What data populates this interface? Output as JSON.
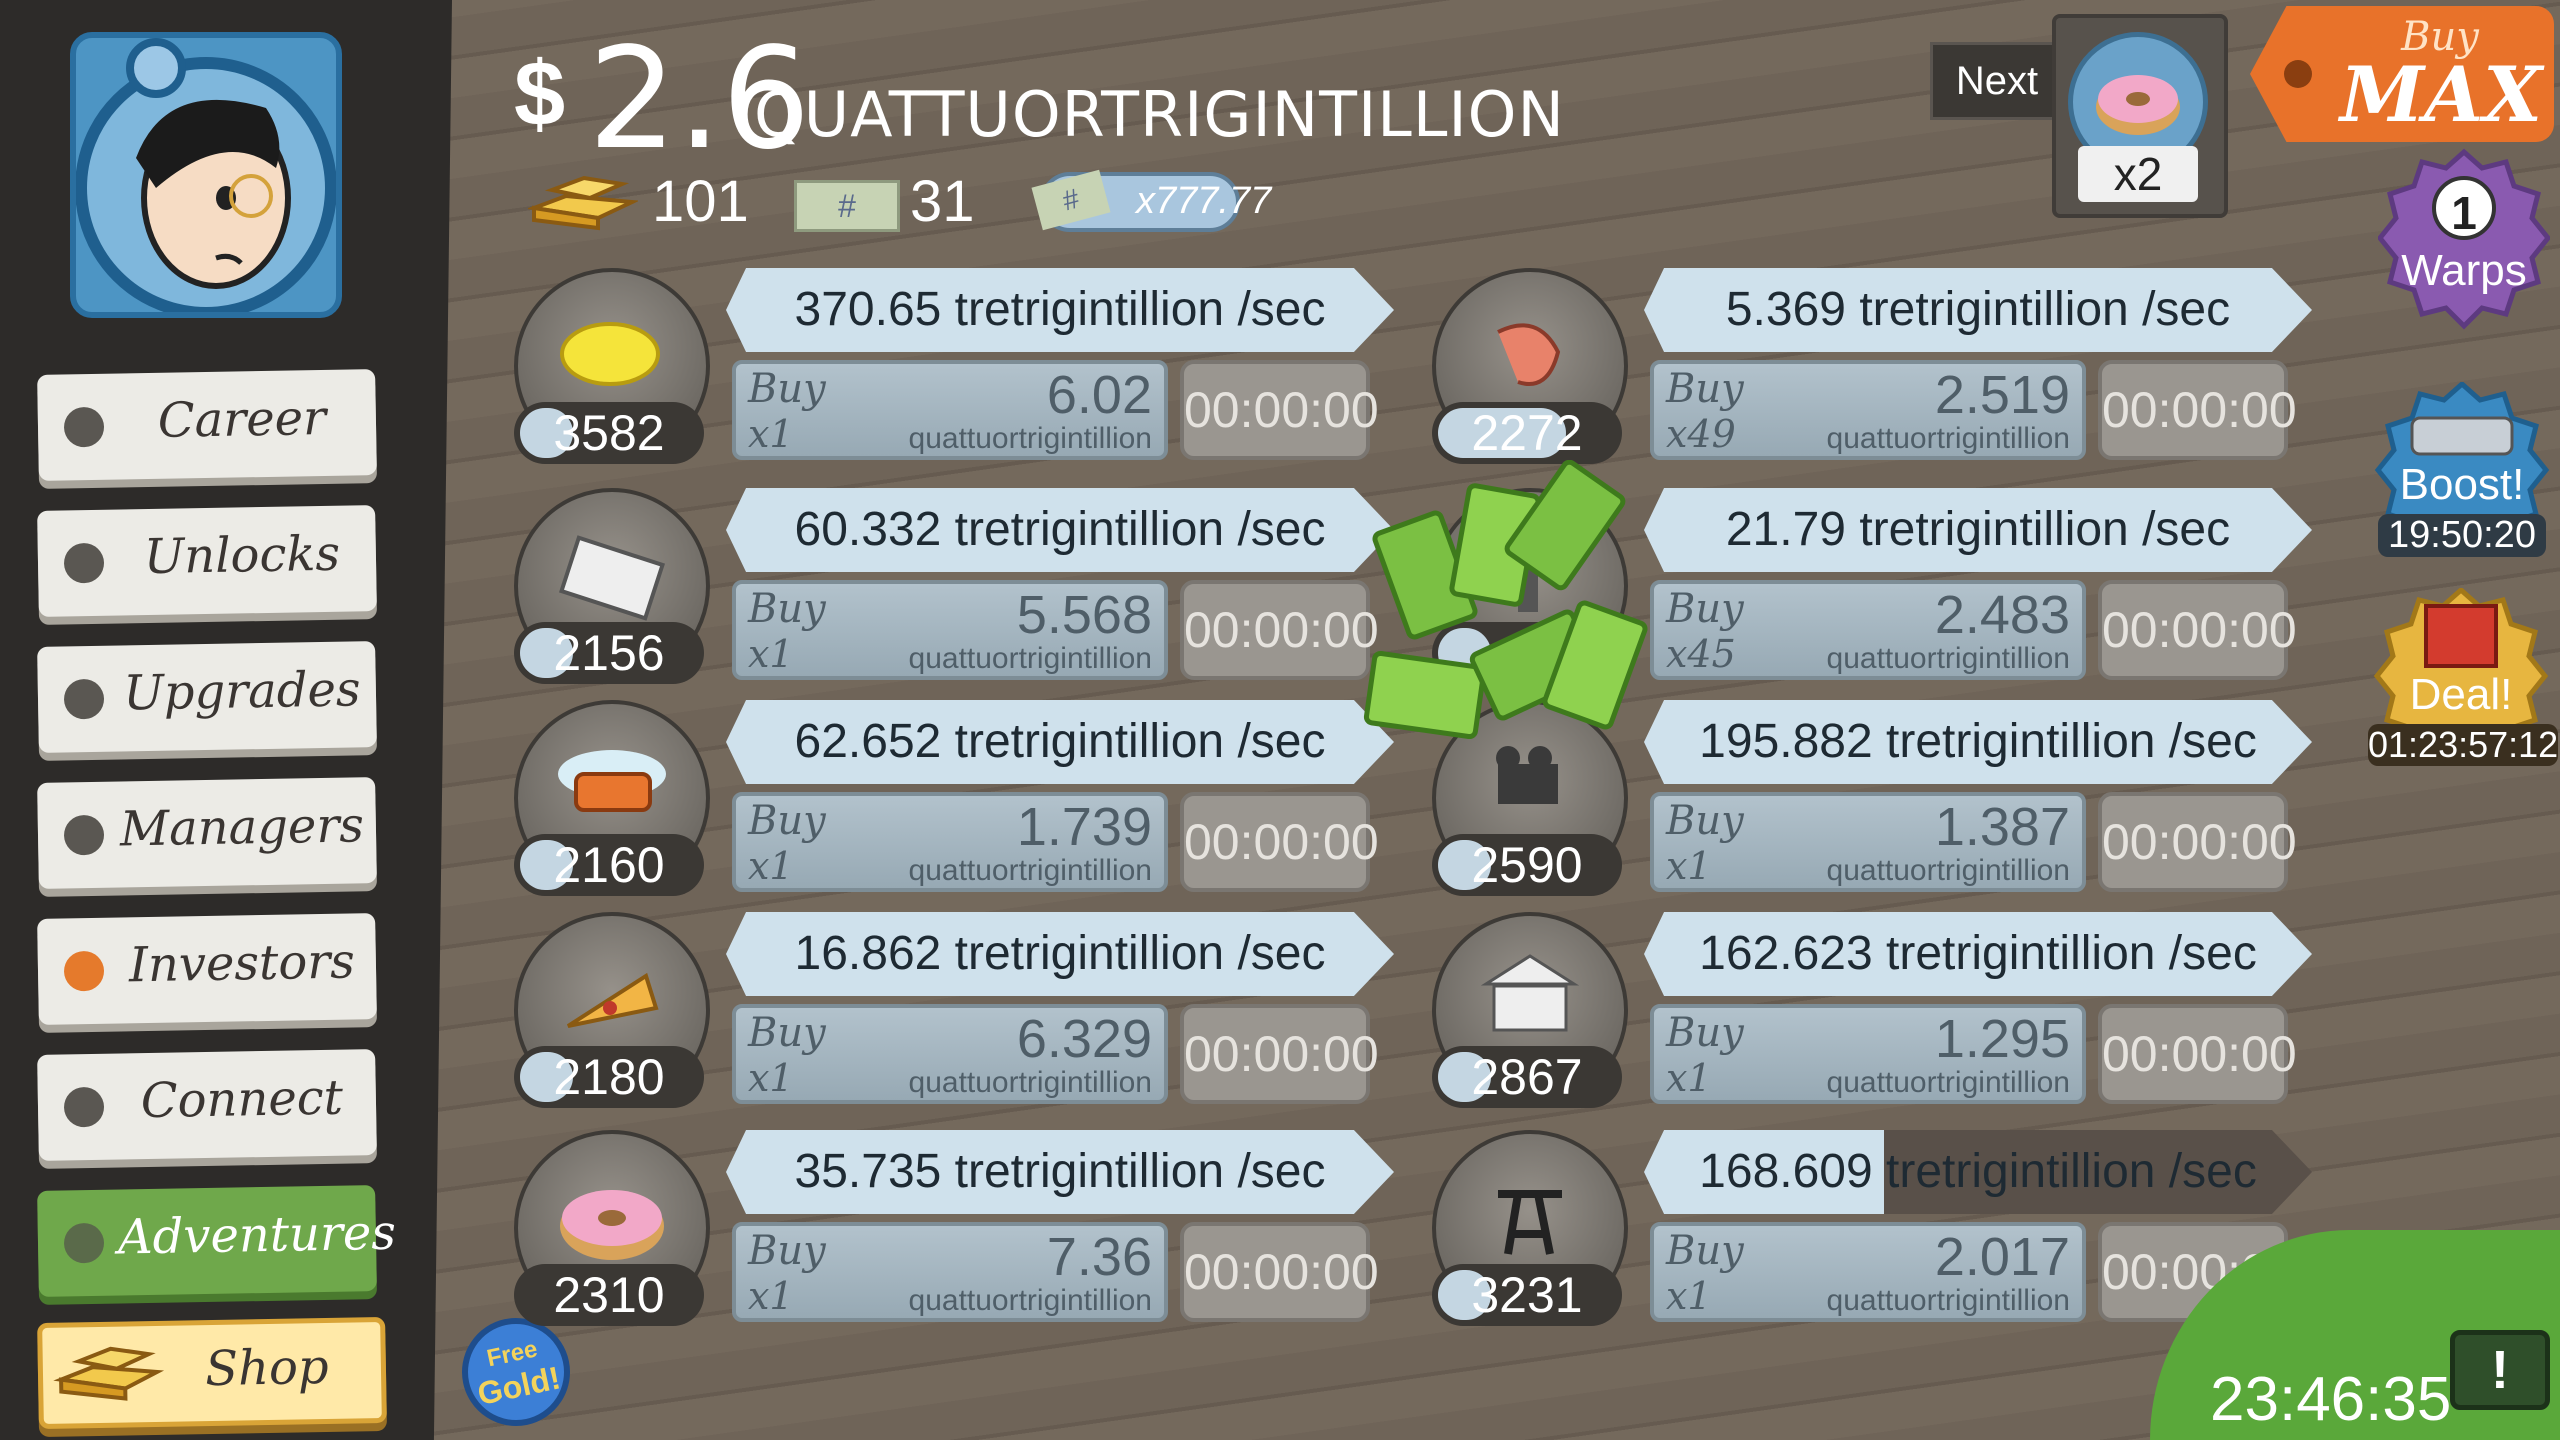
{
  "money": {
    "sign": "$",
    "amount": "2.6",
    "word": "QUATTUORTRIGINTILLION"
  },
  "stats": {
    "gold": "101",
    "tickets": "31",
    "multiplier": "x777.77"
  },
  "nav": [
    {
      "label": "Career"
    },
    {
      "label": "Unlocks"
    },
    {
      "label": "Upgrades"
    },
    {
      "label": "Managers"
    },
    {
      "label": "Investors"
    },
    {
      "label": "Connect"
    },
    {
      "label": "Adventures"
    },
    {
      "label": "Shop"
    }
  ],
  "businesses_left": [
    {
      "icon": "lemon-icon",
      "count": "3582",
      "count_fill": 0.3,
      "rate": "370.65 tretrigintillion /sec",
      "buy_label": "Buy",
      "buy_qty": "x1",
      "price": "6.02",
      "unit": "quattuortrigintillion",
      "timer": "00:00:00"
    },
    {
      "icon": "newspaper-icon",
      "count": "2156",
      "count_fill": 0.3,
      "rate": "60.332 tretrigintillion /sec",
      "buy_label": "Buy",
      "buy_qty": "x1",
      "price": "5.568",
      "unit": "quattuortrigintillion",
      "timer": "00:00:00"
    },
    {
      "icon": "car-wash-icon",
      "count": "2160",
      "count_fill": 0.3,
      "rate": "62.652 tretrigintillion /sec",
      "buy_label": "Buy",
      "buy_qty": "x1",
      "price": "1.739",
      "unit": "quattuortrigintillion",
      "timer": "00:00:00"
    },
    {
      "icon": "pizza-icon",
      "count": "2180",
      "count_fill": 0.3,
      "rate": "16.862 tretrigintillion /sec",
      "buy_label": "Buy",
      "buy_qty": "x1",
      "price": "6.329",
      "unit": "quattuortrigintillion",
      "timer": "00:00:00"
    },
    {
      "icon": "donut-icon",
      "count": "2310",
      "count_fill": 0.0,
      "rate": "35.735 tretrigintillion /sec",
      "buy_label": "Buy",
      "buy_qty": "x1",
      "price": "7.36",
      "unit": "quattuortrigintillion",
      "timer": "00:00:00"
    }
  ],
  "businesses_right": [
    {
      "icon": "shrimp-icon",
      "count": "2272",
      "count_fill": 0.72,
      "rate": "5.369 tretrigintillion /sec",
      "buy_label": "Buy",
      "buy_qty": "x49",
      "price": "2.519",
      "unit": "quattuortrigintillion",
      "timer": "00:00:00"
    },
    {
      "icon": "hockey-icon",
      "count": "",
      "count_fill": 0.3,
      "rate": "21.79 tretrigintillion /sec",
      "buy_label": "Buy",
      "buy_qty": "x45",
      "price": "2.483",
      "unit": "quattuortrigintillion",
      "timer": "00:00:00"
    },
    {
      "icon": "movie-camera-icon",
      "count": "2590",
      "count_fill": 0.3,
      "rate": "195.882 tretrigintillion /sec",
      "buy_label": "Buy",
      "buy_qty": "x1",
      "price": "1.387",
      "unit": "quattuortrigintillion",
      "timer": "00:00:00"
    },
    {
      "icon": "bank-icon",
      "count": "2867",
      "count_fill": 0.3,
      "rate": "162.623 tretrigintillion /sec",
      "buy_label": "Buy",
      "buy_qty": "x1",
      "price": "1.295",
      "unit": "quattuortrigintillion",
      "timer": "00:00:00"
    },
    {
      "icon": "oil-rig-icon",
      "count": "3231",
      "count_fill": 0.3,
      "rate": "168.609 tretrigintillion /sec",
      "rate_progress": 0.36,
      "buy_label": "Buy",
      "buy_qty": "x1",
      "price": "2.017",
      "unit": "quattuortrigintillion",
      "timer": "00:00:00"
    }
  ],
  "next": {
    "label": "Next",
    "multiplier": "x2"
  },
  "buy_max": {
    "top": "Buy",
    "bottom": "MAX"
  },
  "warps": {
    "count": "1",
    "label": "Warps"
  },
  "boost": {
    "label": "Boost!",
    "timer": "19:50:20"
  },
  "deal": {
    "label": "Deal!",
    "timer": "01:23:57:12"
  },
  "free_gold": {
    "top": "Free",
    "bottom": "Gold!"
  },
  "clock": "23:46:35",
  "colors": {
    "sidebar": "#2d2b29",
    "active_nav": "#6fa84b",
    "rate_bar": "#cfe1ec",
    "buy_max": "#e8722a",
    "warps": "#8a5ab0",
    "boost": "#3a8ac2",
    "deal": "#e7b640"
  }
}
